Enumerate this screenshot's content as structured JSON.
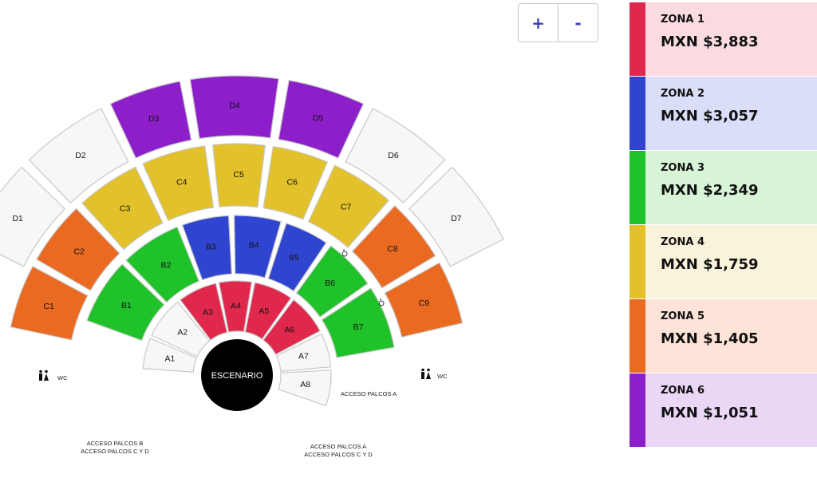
{
  "zoom": {
    "plus": "+",
    "minus": "-"
  },
  "stage": "ESCENARIO",
  "wc": "WC",
  "notes": {
    "left_1": "ACCESO PALCOS B",
    "left_2": "ACCESO PALCOS C Y D",
    "right_1": "ACCESO PALCOS A",
    "right_2": "ACCESO PALCOS C Y D",
    "palcos_a": "ACCESO PALCOS A"
  },
  "zone_colors": {
    "1": "#e0284c",
    "2": "#2f45d0",
    "3": "#1fc229",
    "4": "#e2c12a",
    "5": "#ea6a22",
    "6": "#8d1fcb",
    "none": "#f7f7f7"
  },
  "zones": [
    {
      "name": "ZONA 1",
      "price": "MXN $3,883",
      "color": "#e0284c",
      "bg": "#fadbe2"
    },
    {
      "name": "ZONA 2",
      "price": "MXN $3,057",
      "color": "#2f45d0",
      "bg": "#dbdef8"
    },
    {
      "name": "ZONA 3",
      "price": "MXN $2,349",
      "color": "#1fc229",
      "bg": "#d7f4d7"
    },
    {
      "name": "ZONA 4",
      "price": "MXN $1,759",
      "color": "#e2c12a",
      "bg": "#faf3dc"
    },
    {
      "name": "ZONA 5",
      "price": "MXN $1,405",
      "color": "#ea6a22",
      "bg": "#fde3d8"
    },
    {
      "name": "ZONA 6",
      "price": "MXN $1,051",
      "color": "#8d1fcb",
      "bg": "#ead7f6"
    }
  ],
  "rings": [
    {
      "sections": [
        {
          "label": "A1",
          "zone": "none"
        },
        {
          "label": "A2",
          "zone": "none"
        },
        {
          "label": "A3",
          "zone": "1"
        },
        {
          "label": "A4",
          "zone": "1"
        },
        {
          "label": "A5",
          "zone": "1"
        },
        {
          "label": "A6",
          "zone": "1"
        },
        {
          "label": "A7",
          "zone": "none"
        },
        {
          "label": "A8",
          "zone": "none"
        }
      ]
    },
    {
      "sections": [
        {
          "label": "B1",
          "zone": "3"
        },
        {
          "label": "B2",
          "zone": "3"
        },
        {
          "label": "B3",
          "zone": "2"
        },
        {
          "label": "B4",
          "zone": "2"
        },
        {
          "label": "B5",
          "zone": "2"
        },
        {
          "label": "B6",
          "zone": "3"
        },
        {
          "label": "B7",
          "zone": "3"
        }
      ]
    },
    {
      "sections": [
        {
          "label": "C1",
          "zone": "5"
        },
        {
          "label": "C2",
          "zone": "5"
        },
        {
          "label": "C3",
          "zone": "4"
        },
        {
          "label": "C4",
          "zone": "4"
        },
        {
          "label": "C5",
          "zone": "4"
        },
        {
          "label": "C6",
          "zone": "4"
        },
        {
          "label": "C7",
          "zone": "4"
        },
        {
          "label": "C8",
          "zone": "5"
        },
        {
          "label": "C9",
          "zone": "5"
        }
      ]
    },
    {
      "sections": [
        {
          "label": "D1",
          "zone": "none"
        },
        {
          "label": "D2",
          "zone": "none"
        },
        {
          "label": "D3",
          "zone": "6"
        },
        {
          "label": "D4",
          "zone": "6"
        },
        {
          "label": "D5",
          "zone": "6"
        },
        {
          "label": "D6",
          "zone": "none"
        },
        {
          "label": "D7",
          "zone": "none"
        }
      ]
    }
  ]
}
